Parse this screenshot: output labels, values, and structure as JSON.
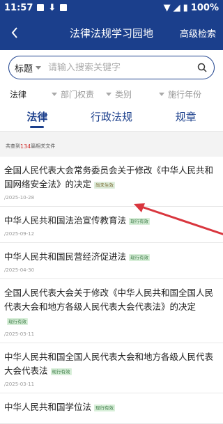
{
  "status_bar": {
    "time": "11:57",
    "battery": "100%"
  },
  "header": {
    "title": "法律法规学习园地",
    "advanced_search": "高级检索"
  },
  "search": {
    "field": "标题",
    "placeholder": "请输入搜索关键字"
  },
  "filters": {
    "category": "法律",
    "department": "部门权责",
    "type": "类别",
    "year": "施行年份"
  },
  "tabs": [
    {
      "label": "法律",
      "active": true
    },
    {
      "label": "行政法规",
      "active": false
    },
    {
      "label": "规章",
      "active": false
    }
  ],
  "result_count": {
    "prefix": "共查到",
    "count": "134",
    "suffix": "篇相关文件"
  },
  "items": [
    {
      "title": "全国人民代表大会常务委员会关于修改《中华人民共和国网络安全法》的决定",
      "badge": "尚未生效",
      "date": "/2025-10-28"
    },
    {
      "title": "中华人民共和国法治宣传教育法",
      "badge": "现行有效",
      "date": "/2025-09-12"
    },
    {
      "title": "中华人民共和国民营经济促进法",
      "badge": "现行有效",
      "date": "/2025-04-30"
    },
    {
      "title": "全国人民代表大会关于修改《中华人民共和国全国人民代表大会和地方各级人民代表大会代表法》的决定",
      "badge": "现行有效",
      "date": "/2025-03-11"
    },
    {
      "title": "中华人民共和国全国人民代表大会和地方各级人民代表大会代表法",
      "badge": "现行有效",
      "date": "/2025-03-11"
    },
    {
      "title": "中华人民共和国学位法",
      "badge": "现行有效",
      "date": ""
    }
  ],
  "colors": {
    "primary": "#1b3f8c",
    "annotation_arrow": "#d9363e",
    "count_highlight": "#d0302f"
  }
}
